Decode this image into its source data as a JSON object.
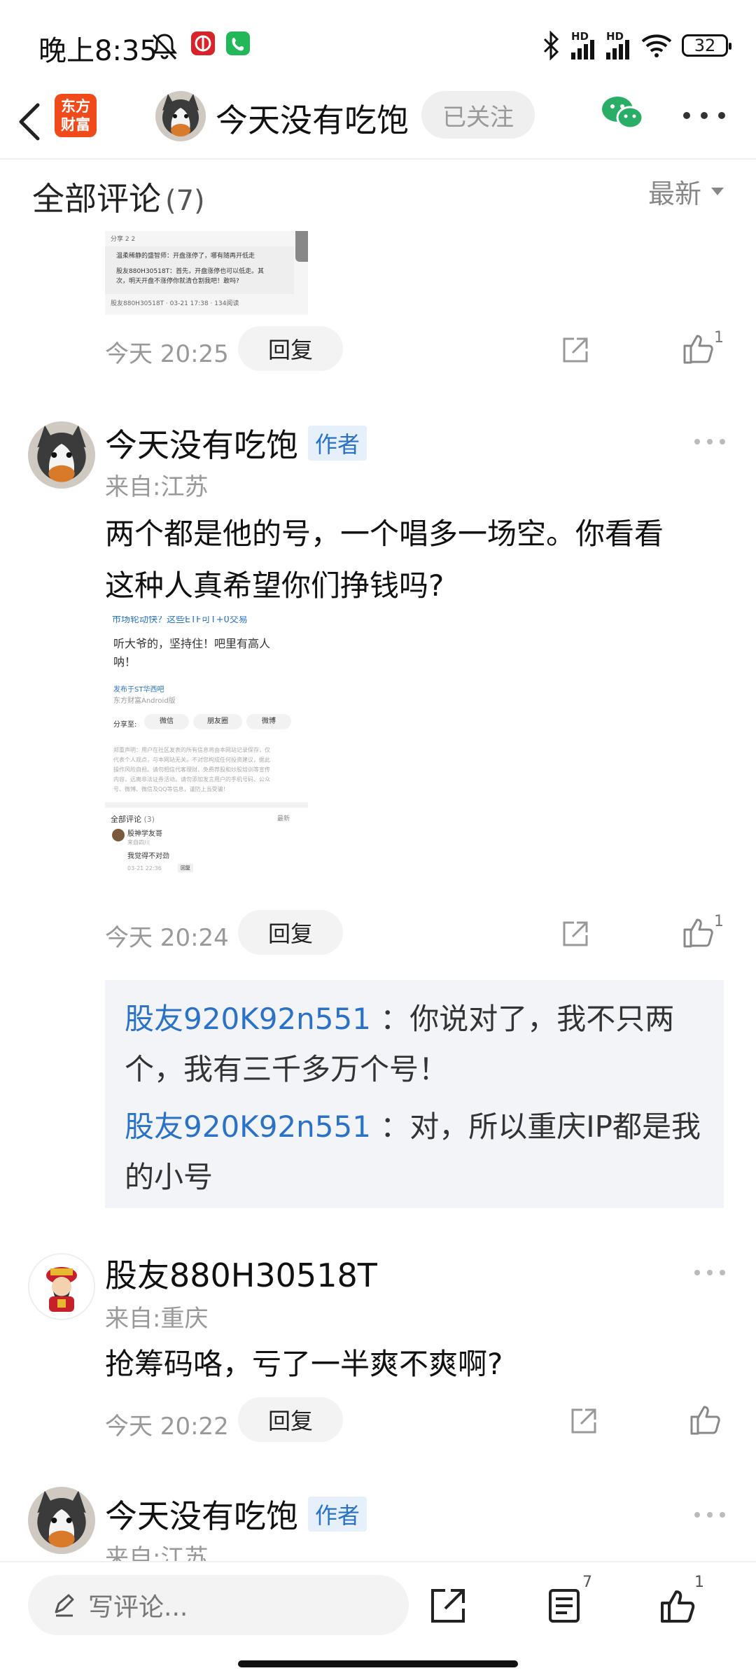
{
  "status": {
    "time": "晚上8:35",
    "battery": "32"
  },
  "header": {
    "app_logo": "东方\n财富",
    "user_name": "今天没有吃饱",
    "follow_label": "已关注"
  },
  "comments": {
    "title": "全部评论",
    "count": "(7)",
    "sort_label": "最新"
  },
  "thumb1": {
    "r1": "分享    2    2",
    "r2": "温柔稀静的盛智师：开盘涨停了，哪有随再开低走",
    "r3": "股友880H30518T：首先，开盘涨停也可以低走。其",
    "r4": "次，明天开盘不涨停你就清仓割我吧！敢吗?",
    "r5": "股友880H30518T · 03-21 17:38 · 134阅读"
  },
  "item0": {
    "time": "今天 20:25",
    "reply_label": "回复",
    "like_count": "1"
  },
  "item1": {
    "name": "今天没有吃饱",
    "tag": "作者",
    "location": "来自:江苏",
    "text_line1": "两个都是他的号，一个唱多一场空。你看看",
    "text_line2": "这种人真希望你们挣钱吗?",
    "time": "今天 20:24",
    "reply_label": "回复",
    "like_count": "1"
  },
  "thumb2": {
    "t0": "市场轮动快？这些ETF可T+0交易",
    "t1": "听大爷的，坚持住！吧里有高人",
    "t2": "呐！",
    "t3": "发布于ST华西吧",
    "t4": "东方财富Android版",
    "share": "分享至:",
    "wx": "微信",
    "pyq": "朋友圈",
    "wb": "微博",
    "d1": "郑重声明：用户在社区发表的所有信息将由本网站记录保存，仅",
    "d2": "代表个人观点，与本网站无关。不对您构成任何投资建议，据此",
    "d3": "操作风险自担。请勿相信代客理财、免费荐股和炒股培训等宣传",
    "d4": "内容，远离非法证券活动。请勿添加发言用户的手机号码、公众",
    "d5": "号、微博、微信及QQ等信息，谨防上当受骗！",
    "c_title": "全部评论",
    "c_count": "(3)",
    "c_sort": "最新",
    "c_user": "股神学友哥",
    "c_loc": "来自四川",
    "c_text": "我觉得不对劲",
    "c_time": "03-21 22:36",
    "c_reply": "回复"
  },
  "replies": [
    {
      "user": "股友920K92n551",
      "text_a": "：你说对了，我不只两",
      "text_b": "个，我有三千多万个号！"
    },
    {
      "user": "股友920K92n551",
      "text_a": "：对，所以重庆IP都是我",
      "text_b": "的小号"
    }
  ],
  "item2": {
    "name": "股友880H30518T",
    "location": "来自:重庆",
    "text": "抢筹码咯，亏了一半爽不爽啊?",
    "time": "今天 20:22",
    "reply_label": "回复"
  },
  "item3": {
    "name": "今天没有吃饱",
    "tag": "作者",
    "location": "来自:江苏"
  },
  "bottom": {
    "write_placeholder": "写评论...",
    "comment_count": "7",
    "like_count": "1"
  }
}
